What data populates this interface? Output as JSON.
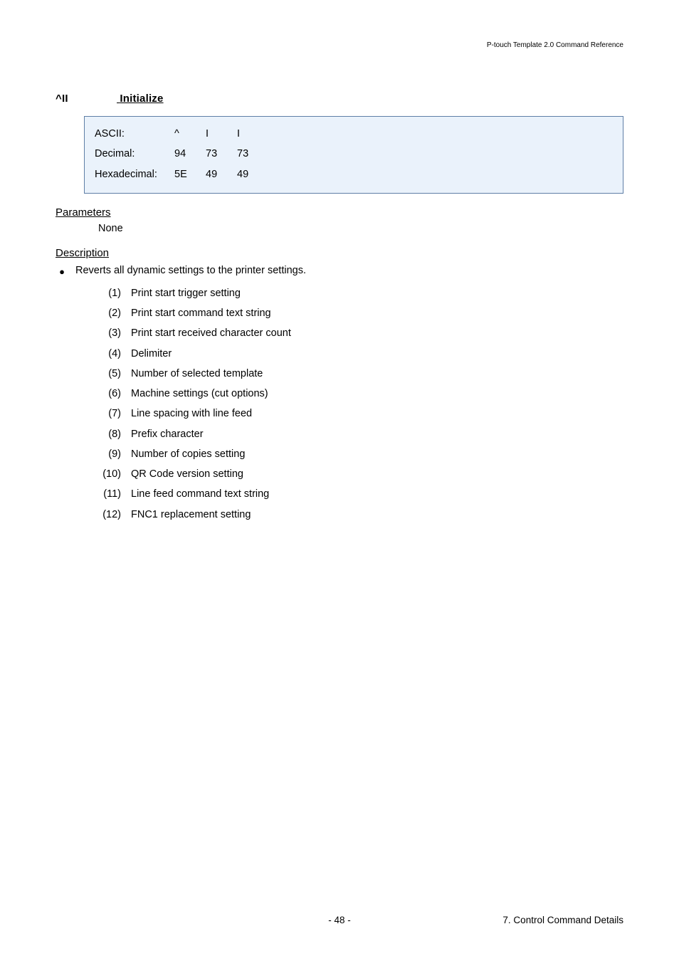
{
  "header": {
    "right": "P-touch Template 2.0 Command Reference"
  },
  "title": {
    "cmd": "^II",
    "name": "Initialize"
  },
  "codebox": {
    "rows": [
      {
        "label": "ASCII:",
        "v1": "^",
        "v2": "I",
        "v3": "I"
      },
      {
        "label": "Decimal:",
        "v1": "94",
        "v2": "73",
        "v3": "73"
      },
      {
        "label": "Hexadecimal:",
        "v1": "5E",
        "v2": "49",
        "v3": "49"
      }
    ]
  },
  "parameters": {
    "heading": "Parameters",
    "value": "None"
  },
  "description": {
    "heading": "Description",
    "bullet_text": "Reverts all dynamic settings to the printer settings.",
    "items": [
      {
        "n": "(1)",
        "t": "Print start trigger setting"
      },
      {
        "n": "(2)",
        "t": "Print start command text string"
      },
      {
        "n": "(3)",
        "t": "Print start received character count"
      },
      {
        "n": "(4)",
        "t": "Delimiter"
      },
      {
        "n": "(5)",
        "t": "Number of selected template"
      },
      {
        "n": "(6)",
        "t": "Machine settings (cut options)"
      },
      {
        "n": "(7)",
        "t": "Line spacing with line feed"
      },
      {
        "n": "(8)",
        "t": "Prefix character"
      },
      {
        "n": "(9)",
        "t": "Number of copies setting"
      },
      {
        "n": "(10)",
        "t": "QR Code version setting"
      },
      {
        "n": "(11)",
        "t": "Line feed command text string"
      },
      {
        "n": "(12)",
        "t": "FNC1 replacement setting"
      }
    ]
  },
  "footer": {
    "page": "- 48 -",
    "right": "7. Control Command Details"
  }
}
